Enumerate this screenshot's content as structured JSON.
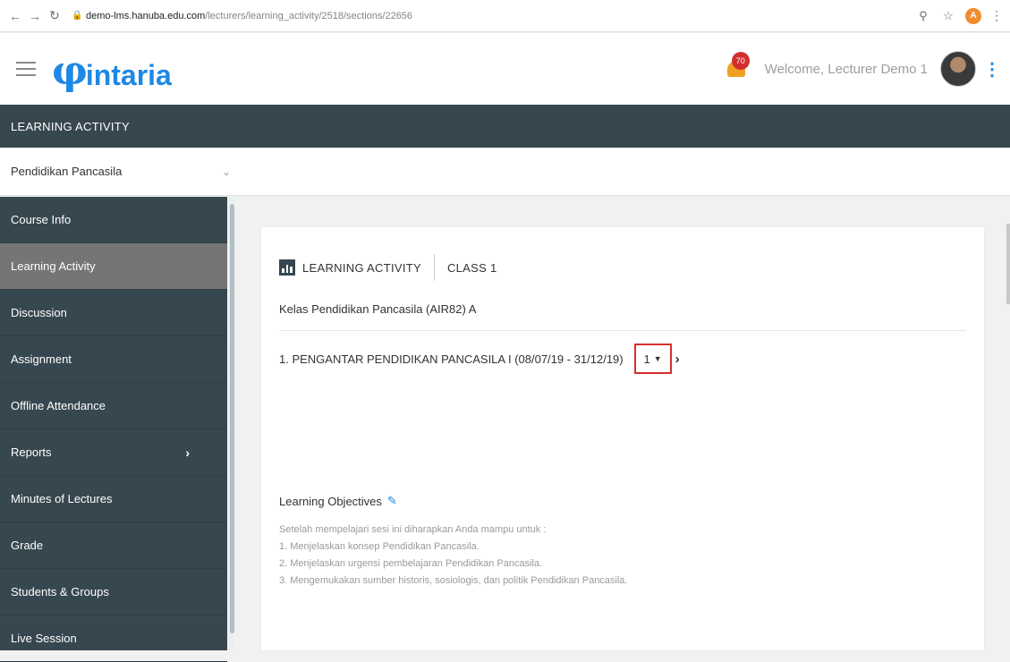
{
  "browser": {
    "url_host": "demo-lms.hanuba.edu.com",
    "url_path": "/lecturers/learning_activity/2518/sections/22656"
  },
  "header": {
    "logo_text": "intaria",
    "notification_count": "70",
    "welcome": "Welcome, Lecturer Demo 1"
  },
  "section_title": "LEARNING ACTIVITY",
  "course_selector": {
    "value": "Pendidikan Pancasila"
  },
  "sidebar": {
    "items": [
      {
        "label": "Course Info",
        "active": false
      },
      {
        "label": "Learning Activity",
        "active": true
      },
      {
        "label": "Discussion",
        "active": false
      },
      {
        "label": "Assignment",
        "active": false
      },
      {
        "label": "Offline Attendance",
        "active": false
      },
      {
        "label": "Reports",
        "active": false,
        "has_submenu": true
      },
      {
        "label": "Minutes of Lectures",
        "active": false
      },
      {
        "label": "Grade",
        "active": false
      },
      {
        "label": "Students & Groups",
        "active": false
      },
      {
        "label": "Live Session",
        "active": false
      }
    ]
  },
  "card": {
    "title": "LEARNING ACTIVITY",
    "class_label": "CLASS  1",
    "class_name": "Kelas Pendidikan Pancasila (AIR82) A",
    "topic": "1. PENGANTAR PENDIDIKAN PANCASILA I (08/07/19 - 31/12/19)",
    "session_select": "1",
    "objectives_title": "Learning Objectives",
    "objectives_intro": "Setelah mempelajari sesi ini diharapkan Anda mampu untuk :",
    "objectives": [
      "1. Menjelaskan konsep Pendidikan Pancasila.",
      "2. Menjelaskan urgensi pembelajaran Pendidikan Pancasila.",
      "3. Mengemukakan sumber historis, sosiologis, dan politik Pendidikan Pancasila."
    ]
  },
  "colors": {
    "sidebar_bg": "#37474f",
    "sidebar_active": "#757575",
    "brand_blue": "#1e88e5",
    "highlight_red": "#d32f2f"
  }
}
